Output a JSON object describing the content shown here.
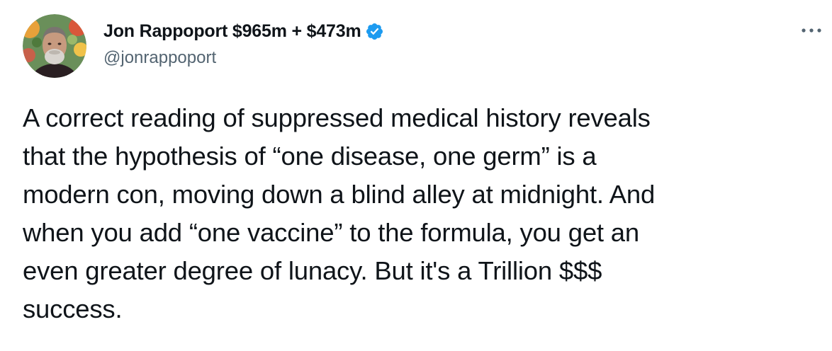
{
  "author": {
    "display_name": "Jon Rappoport $965m + $473m",
    "handle": "@jonrappoport",
    "avatar_icon": "avatar-photo",
    "verified_icon": "verified-badge-icon",
    "verified_color": "#1d9bf0"
  },
  "actions": {
    "more_icon": "more-options-icon"
  },
  "tweet": {
    "text": "A correct reading of suppressed medical history reveals\nthat the hypothesis of “one disease, one germ” is a\nmodern con, moving down a blind alley at midnight. And\nwhen you add “one vaccine” to the formula, you get an\neven greater degree of lunacy. But it's a Trillion $$$\nsuccess."
  },
  "colors": {
    "text_primary": "#0f1419",
    "text_secondary": "#536471",
    "background": "#ffffff"
  }
}
